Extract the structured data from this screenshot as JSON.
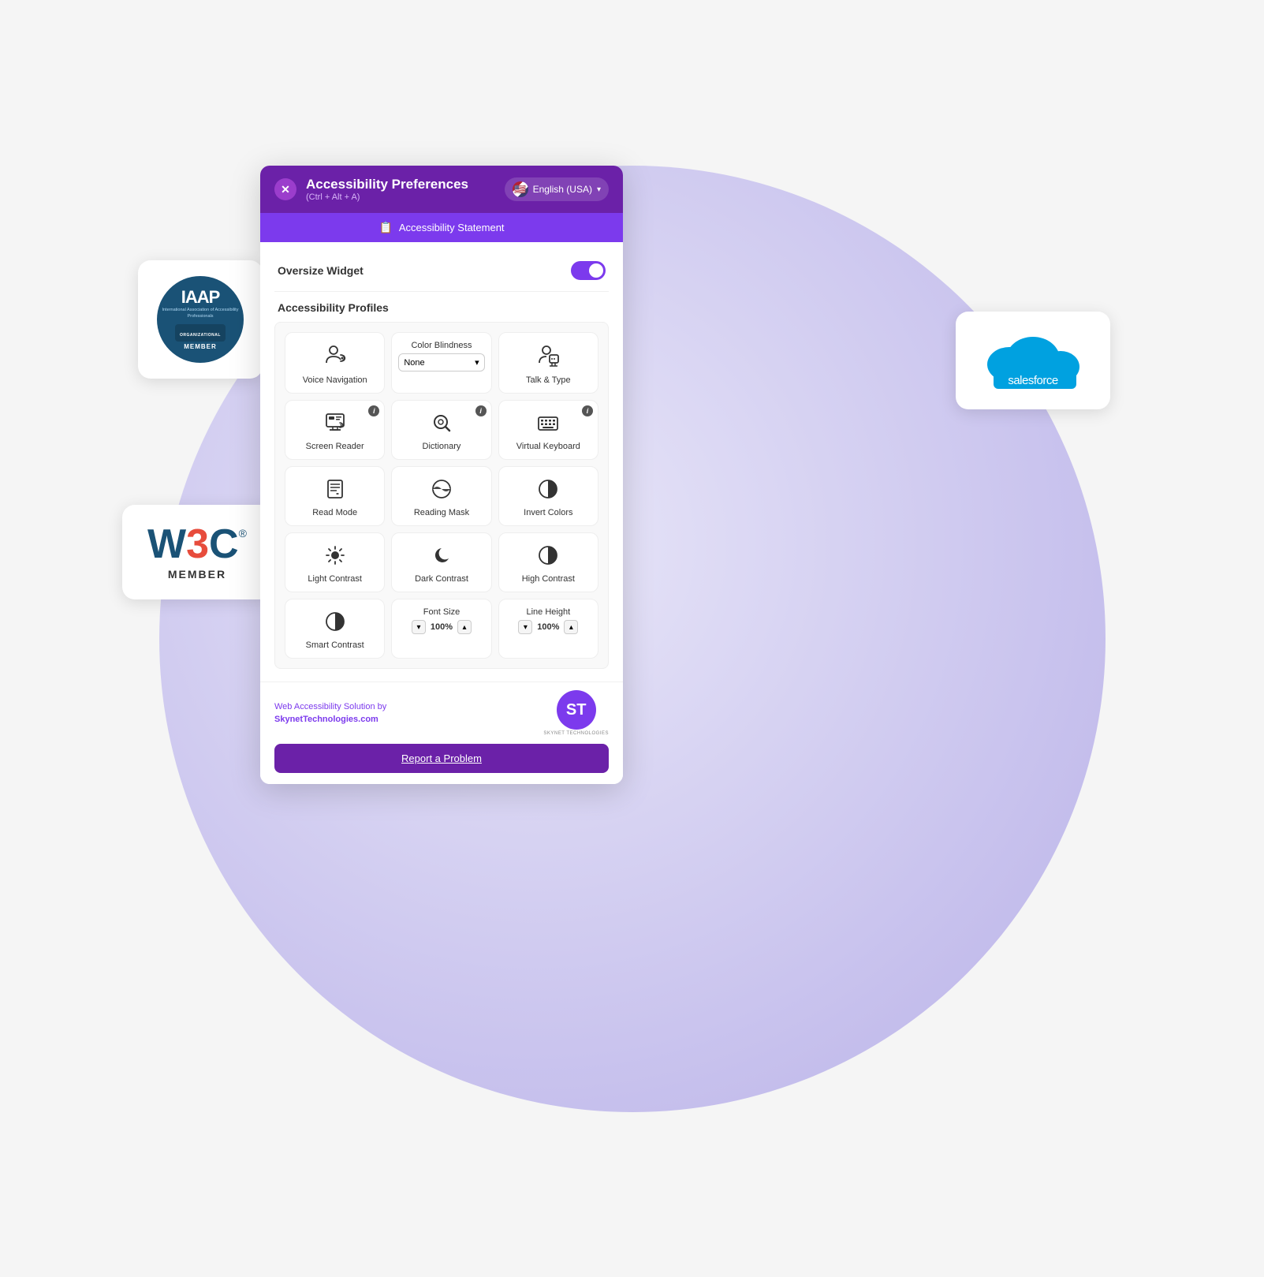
{
  "scene": {
    "bg_color": "#e8e4f5"
  },
  "iaap": {
    "title": "IAAP",
    "subtitle": "International Association of Accessibility Professionals",
    "org_label": "ORGANIZATIONAL",
    "member_label": "MEMBER"
  },
  "w3c": {
    "logo": "W3C",
    "registered": "®",
    "member": "MEMBER"
  },
  "salesforce": {
    "name": "salesforce"
  },
  "widget": {
    "header": {
      "title": "Accessibility Preferences",
      "shortcut": "(Ctrl + Alt + A)",
      "lang": "English (USA)",
      "close_label": "✕"
    },
    "statement_bar": {
      "icon": "📋",
      "label": "Accessibility Statement"
    },
    "oversize": {
      "label": "Oversize Widget"
    },
    "profiles": {
      "label": "Accessibility Profiles"
    },
    "items": [
      {
        "id": "voice-nav",
        "label": "Voice Navigation",
        "icon": "🗣",
        "info": false
      },
      {
        "id": "color-blindness",
        "label": "Color Blindness",
        "type": "select",
        "options": [
          "None"
        ],
        "info": false
      },
      {
        "id": "talk-type",
        "label": "Talk & Type",
        "icon": "💬",
        "info": false
      },
      {
        "id": "screen-reader",
        "label": "Screen Reader",
        "icon": "📺",
        "info": true
      },
      {
        "id": "dictionary",
        "label": "Dictionary",
        "icon": "🔍",
        "info": true
      },
      {
        "id": "virtual-keyboard",
        "label": "Virtual Keyboard",
        "icon": "⌨",
        "info": true
      },
      {
        "id": "read-mode",
        "label": "Read Mode",
        "icon": "📄",
        "info": false
      },
      {
        "id": "reading-mask",
        "label": "Reading Mask",
        "icon": "◑",
        "info": false
      },
      {
        "id": "invert-colors",
        "label": "Invert Colors",
        "icon": "◐",
        "info": false
      },
      {
        "id": "light-contrast",
        "label": "Light Contrast",
        "icon": "☀",
        "info": false
      },
      {
        "id": "dark-contrast",
        "label": "Dark Contrast",
        "icon": "🌙",
        "info": false
      },
      {
        "id": "high-contrast",
        "label": "High Contrast",
        "icon": "◑",
        "info": false
      },
      {
        "id": "smart-contrast",
        "label": "Smart Contrast",
        "icon": "◕",
        "info": false
      }
    ],
    "font_size": {
      "label": "Font Size",
      "value": "100%"
    },
    "line_height": {
      "label": "Line Height",
      "value": "100%"
    },
    "footer": {
      "branding_text": "Web Accessibility Solution by",
      "branding_link": "SkynetTechnologies.com",
      "logo_text": "ST",
      "logo_sub": "SKYNET TECHNOLOGIES"
    },
    "report_btn": "Report a Problem"
  }
}
